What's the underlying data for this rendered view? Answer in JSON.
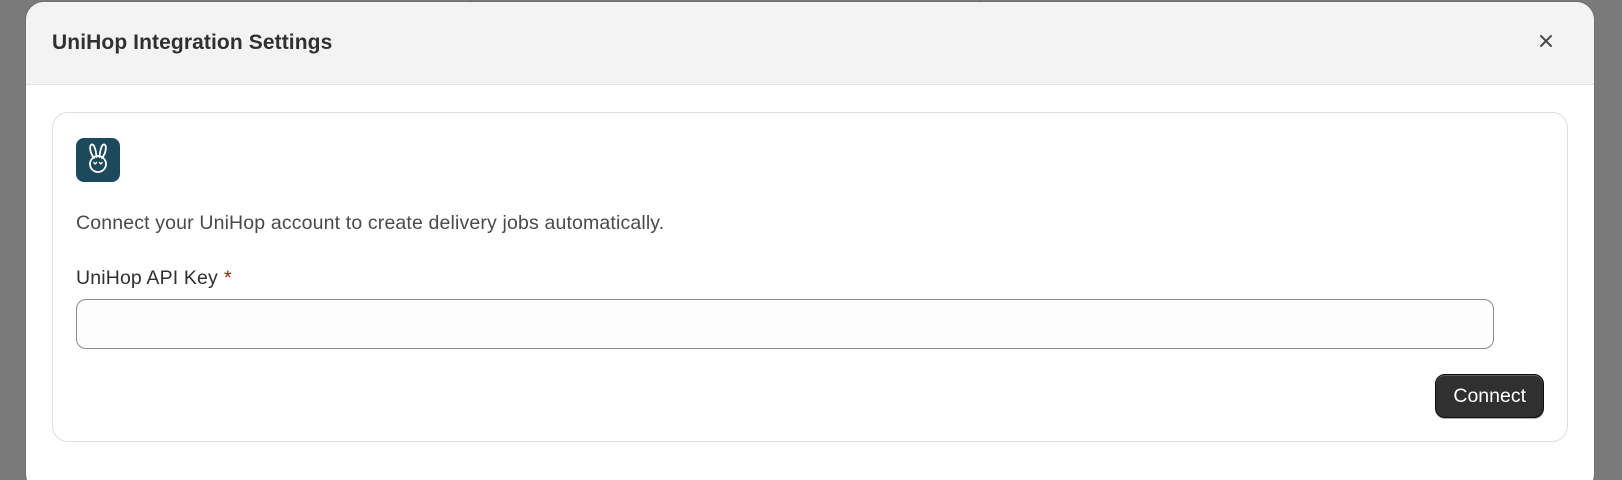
{
  "modal": {
    "title": "UniHop Integration Settings",
    "close_icon": "close-icon"
  },
  "app": {
    "logo_icon": "rabbit-icon",
    "logo_color": "#1c4a5c",
    "description": "Connect your UniHop account to create delivery jobs automatically."
  },
  "form": {
    "api_key_label": "UniHop API Key",
    "required_marker": "*",
    "api_key_value": "",
    "api_key_placeholder": ""
  },
  "actions": {
    "connect_label": "Connect"
  },
  "colors": {
    "primary_button": "#303030",
    "required": "#8e1f0b",
    "header_bg": "#f3f3f3",
    "overlay": "#7a7a7a"
  }
}
